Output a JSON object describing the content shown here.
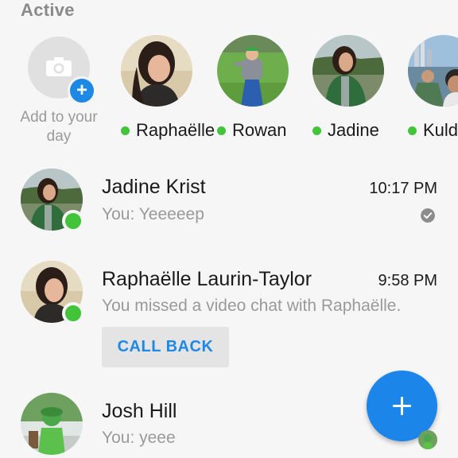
{
  "section": {
    "title": "Active"
  },
  "add_story": {
    "label": "Add to your day"
  },
  "stories": [
    {
      "name": "Raphaëlle",
      "online": true
    },
    {
      "name": "Rowan",
      "online": true
    },
    {
      "name": "Jadine",
      "online": true
    },
    {
      "name": "Kulde",
      "online": true
    }
  ],
  "conversations": [
    {
      "name": "Jadine Krist",
      "time": "10:17 PM",
      "snippet": "You: Yeeeeep",
      "online": true,
      "seen": true
    },
    {
      "name": "Raphaëlle Laurin-Taylor",
      "time": "9:58 PM",
      "snippet": "You missed a video chat with Raphaëlle.",
      "online": true,
      "action": "CALL BACK"
    },
    {
      "name": "Josh Hill",
      "snippet": "You: yeee",
      "online": false
    }
  ],
  "colors": {
    "accent": "#1e88e5",
    "online": "#42c33a",
    "background": "#f6f6f6"
  },
  "icons": {
    "add_story": "camera-icon",
    "add_badge": "plus-icon",
    "seen": "check-circle-icon",
    "fab": "plus-icon"
  }
}
